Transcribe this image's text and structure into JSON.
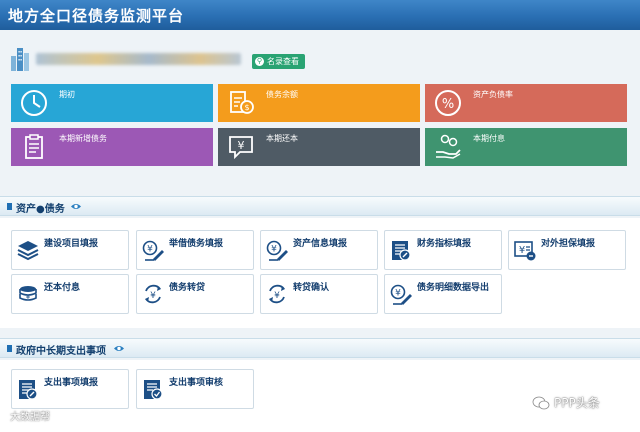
{
  "app": {
    "title": "地方全口径债务监测平台"
  },
  "banner": {
    "list_button": "名录查看",
    "list_icon": "search-icon"
  },
  "tiles": [
    {
      "label": "期初",
      "color": "#27a6d6",
      "icon": "clock-icon"
    },
    {
      "label": "债务余额",
      "color": "#f49c1c",
      "icon": "document-coin-icon"
    },
    {
      "label": "资产负债率",
      "color": "#d56a5a",
      "icon": "percent-icon"
    },
    {
      "label": "本期新增债务",
      "color": "#9c58b5",
      "icon": "clipboard-icon"
    },
    {
      "label": "本期还本",
      "color": "#4f5b65",
      "icon": "yen-chat-icon"
    },
    {
      "label": "本期付息",
      "color": "#3f9470",
      "icon": "hand-coins-icon"
    }
  ],
  "sections": [
    {
      "title": "资产●债务",
      "cards": [
        {
          "label": "建设项目填报",
          "icon": "layers-icon"
        },
        {
          "label": "举借债务填报",
          "icon": "yen-pen-icon"
        },
        {
          "label": "资产信息填报",
          "icon": "yen-pen-icon"
        },
        {
          "label": "财务指标填报",
          "icon": "chart-doc-icon"
        },
        {
          "label": "对外担保填报",
          "icon": "yen-bill-icon"
        },
        {
          "label": "还本付息",
          "icon": "coins-icon"
        },
        {
          "label": "债务转贷",
          "icon": "yen-cycle-icon"
        },
        {
          "label": "转贷确认",
          "icon": "yen-cycle-icon"
        },
        {
          "label": "债务明细数据导出",
          "icon": "yen-pen-icon"
        }
      ]
    },
    {
      "title": "政府中长期支出事项",
      "cards": [
        {
          "label": "支出事项填报",
          "icon": "chart-doc-icon"
        },
        {
          "label": "支出事项审核",
          "icon": "doc-check-icon"
        }
      ]
    }
  ],
  "watermarks": {
    "left": "大数据帮",
    "right": "PPP头条"
  }
}
